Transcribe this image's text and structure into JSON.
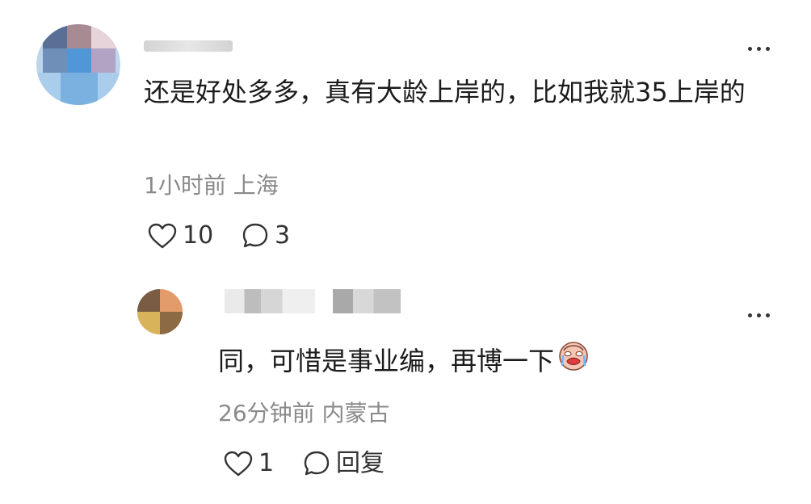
{
  "comment": {
    "text": "还是好处多多，真有大龄上岸的，比如我就35上岸的",
    "meta": "1小时前 上海",
    "likes": "10",
    "replies": "3"
  },
  "reply": {
    "text": "同，可惜是事业编，再博一下",
    "emoji": "crying-face-emoji",
    "meta": "26分钟前 内蒙古",
    "likes": "1",
    "reply_label": "回复"
  },
  "icons": {
    "like": "heart-outline-icon",
    "comment": "speech-bubble-icon",
    "more": "more-dots-icon"
  }
}
